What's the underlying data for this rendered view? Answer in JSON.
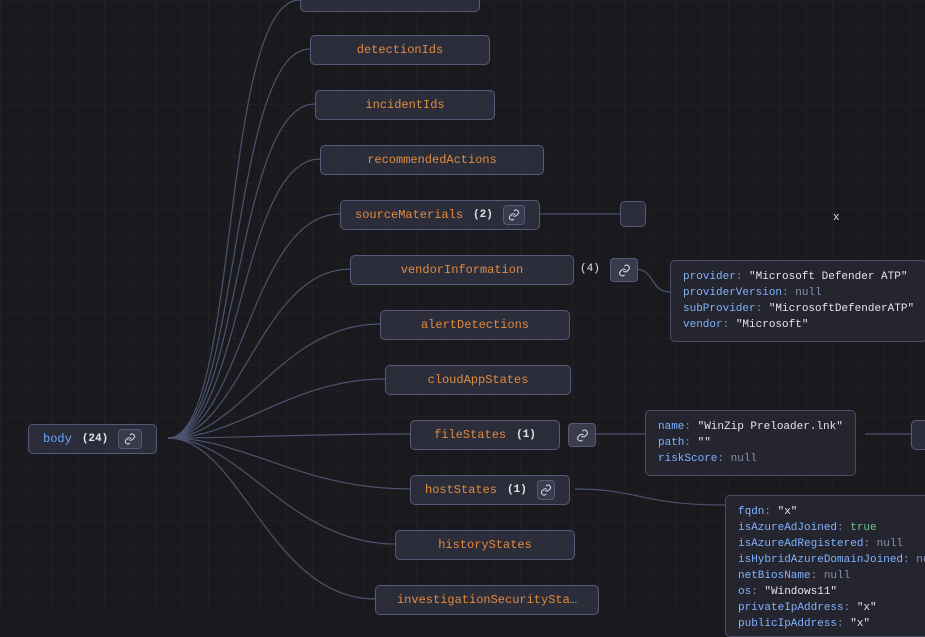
{
  "root": {
    "label": "body",
    "count": "(24)"
  },
  "nodes": {
    "detectionIds": {
      "label": "detectionIds"
    },
    "incidentIds": {
      "label": "incidentIds"
    },
    "recommendedActions": {
      "label": "recommendedActions"
    },
    "sourceMaterials": {
      "label": "sourceMaterials",
      "count": "(2)"
    },
    "vendorInformation": {
      "label": "vendorInformation",
      "count": "(4)"
    },
    "alertDetections": {
      "label": "alertDetections"
    },
    "cloudAppStates": {
      "label": "cloudAppStates"
    },
    "fileStates": {
      "label": "fileStates",
      "count": "(1)"
    },
    "hostStates": {
      "label": "hostStates",
      "count": "(1)"
    },
    "historyStates": {
      "label": "historyStates"
    },
    "investigationSecurityStates": {
      "label": "investigationSecuritySta…"
    }
  },
  "vendorInformationDetail": [
    {
      "k": "provider",
      "v": "\"Microsoft Defender ATP\"",
      "t": "str"
    },
    {
      "k": "providerVersion",
      "v": "null",
      "t": "null"
    },
    {
      "k": "subProvider",
      "v": "\"MicrosoftDefenderATP\"",
      "t": "str"
    },
    {
      "k": "vendor",
      "v": "\"Microsoft\"",
      "t": "str"
    }
  ],
  "fileStatesDetail": [
    {
      "k": "name",
      "v": "\"WinZip Preloader.lnk\"",
      "t": "str"
    },
    {
      "k": "path",
      "v": "\"\"",
      "t": "str"
    },
    {
      "k": "riskScore",
      "v": "null",
      "t": "null"
    }
  ],
  "hostStatesDetail": [
    {
      "k": "fqdn",
      "v": "\"x\"",
      "t": "str"
    },
    {
      "k": "isAzureAdJoined",
      "v": "true",
      "t": "true"
    },
    {
      "k": "isAzureAdRegistered",
      "v": "null",
      "t": "null"
    },
    {
      "k": "isHybridAzureDomainJoined",
      "v": "null",
      "t": "null"
    },
    {
      "k": "netBiosName",
      "v": "null",
      "t": "null"
    },
    {
      "k": "os",
      "v": "\"Windows11\"",
      "t": "str"
    },
    {
      "k": "privateIpAddress",
      "v": "\"x\"",
      "t": "str"
    },
    {
      "k": "publicIpAddress",
      "v": "\"x\"",
      "t": "str"
    }
  ],
  "strayX": "x"
}
